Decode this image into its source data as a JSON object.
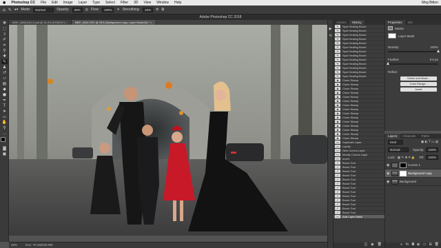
{
  "menubar": {
    "app": "Photoshop CC",
    "items": [
      "File",
      "Edit",
      "Image",
      "Layer",
      "Type",
      "Select",
      "Filter",
      "3D",
      "View",
      "Window",
      "Help"
    ],
    "user": "Meg Bitton"
  },
  "options": {
    "mode_label": "Mode:",
    "mode_value": "Normal",
    "opacity_label": "Opacity:",
    "opacity_value": "40%",
    "flow_label": "Flow:",
    "flow_value": "100%",
    "smoothing_label": "Smoothing:",
    "smoothing_value": "10%"
  },
  "window_title": "Adobe Photoshop CC 2018",
  "tabs": [
    {
      "label": "MBP_4585-644-2.psd @ 33.3% (RGB/16*)"
    },
    {
      "label": "MBP_4634.CR2 @ 25% (Background copy, Layer Mask/16) *"
    }
  ],
  "status": {
    "zoom": "25%",
    "doc": "Doc: 70.1M/234.9M"
  },
  "tools": [
    "move-icon",
    "marquee-icon",
    "lasso-icon",
    "quick-select-icon",
    "crop-icon",
    "eyedropper-icon",
    "healing-icon",
    "brush-icon",
    "clone-stamp-icon",
    "history-brush-icon",
    "eraser-icon",
    "gradient-icon",
    "blur-icon",
    "dodge-icon",
    "pen-icon",
    "type-icon",
    "path-select-icon",
    "rectangle-icon",
    "hand-icon",
    "zoom-icon",
    "more-icon",
    "colors-icon"
  ],
  "history": {
    "tabs": [
      "Actions",
      "History"
    ],
    "items": [
      {
        "label": "Spot Healing Brush",
        "icon": "spot-heal-icon"
      },
      {
        "label": "Spot Healing Brush",
        "icon": "spot-heal-icon"
      },
      {
        "label": "Spot Healing Brush",
        "icon": "spot-heal-icon"
      },
      {
        "label": "Spot Healing Brush",
        "icon": "spot-heal-icon"
      },
      {
        "label": "Spot Healing Brush",
        "icon": "spot-heal-icon"
      },
      {
        "label": "Spot Healing Brush",
        "icon": "spot-heal-icon"
      },
      {
        "label": "Spot Healing Brush",
        "icon": "spot-heal-icon"
      },
      {
        "label": "Spot Healing Brush",
        "icon": "spot-heal-icon"
      },
      {
        "label": "Spot Healing Brush",
        "icon": "spot-heal-icon"
      },
      {
        "label": "Spot Healing Brush",
        "icon": "spot-heal-icon"
      },
      {
        "label": "Spot Healing Brush",
        "icon": "spot-heal-icon"
      },
      {
        "label": "Spot Healing Brush",
        "icon": "spot-heal-icon"
      },
      {
        "label": "Spot Healing Brush",
        "icon": "spot-heal-icon"
      },
      {
        "label": "Clone Stamp",
        "icon": "clone-stamp-icon"
      },
      {
        "label": "Clone Stamp",
        "icon": "clone-stamp-icon"
      },
      {
        "label": "Clone Stamp",
        "icon": "clone-stamp-icon"
      },
      {
        "label": "Clone Stamp",
        "icon": "clone-stamp-icon"
      },
      {
        "label": "Clone Stamp",
        "icon": "clone-stamp-icon"
      },
      {
        "label": "Clone Stamp",
        "icon": "clone-stamp-icon"
      },
      {
        "label": "Clone Stamp",
        "icon": "clone-stamp-icon"
      },
      {
        "label": "Clone Stamp",
        "icon": "clone-stamp-icon"
      },
      {
        "label": "Clone Stamp",
        "icon": "clone-stamp-icon"
      },
      {
        "label": "Clone Stamp",
        "icon": "clone-stamp-icon"
      },
      {
        "label": "Clone Stamp",
        "icon": "clone-stamp-icon"
      },
      {
        "label": "Clone Stamp",
        "icon": "clone-stamp-icon"
      },
      {
        "label": "Clone Stamp",
        "icon": "clone-stamp-icon"
      },
      {
        "label": "Clone Stamp",
        "icon": "clone-stamp-icon"
      },
      {
        "label": "Clone Stamp",
        "icon": "clone-stamp-icon"
      },
      {
        "label": "Duplicate Layer",
        "icon": "layer-icon"
      },
      {
        "label": "Liquify",
        "icon": "layer-icon"
      },
      {
        "label": "New Curves Layer",
        "icon": "layer-icon"
      },
      {
        "label": "Modify Curves Layer",
        "icon": "layer-icon"
      },
      {
        "label": "Invert",
        "icon": "layer-icon"
      },
      {
        "label": "Brush Tool",
        "icon": "brush-icon"
      },
      {
        "label": "Brush Tool",
        "icon": "brush-icon"
      },
      {
        "label": "Brush Tool",
        "icon": "brush-icon"
      },
      {
        "label": "Brush Tool",
        "icon": "brush-icon"
      },
      {
        "label": "Brush Tool",
        "icon": "brush-icon"
      },
      {
        "label": "Brush Tool",
        "icon": "brush-icon"
      },
      {
        "label": "Brush Tool",
        "icon": "brush-icon"
      },
      {
        "label": "Brush Tool",
        "icon": "brush-icon"
      },
      {
        "label": "Brush Tool",
        "icon": "brush-icon"
      },
      {
        "label": "Brush Tool",
        "icon": "brush-icon"
      },
      {
        "label": "Brush Tool",
        "icon": "brush-icon"
      },
      {
        "label": "Brush Tool",
        "icon": "brush-icon"
      },
      {
        "label": "Brush Tool",
        "icon": "brush-icon"
      },
      {
        "label": "Add Layer Mask",
        "icon": "layer-icon",
        "active": true
      }
    ]
  },
  "properties": {
    "tabs": [
      "Properties",
      "Info"
    ],
    "section": "Masks",
    "layer_mask_label": "Layer Mask",
    "density_label": "Density:",
    "density_value": "100%",
    "density_fraction": 1.0,
    "feather_label": "Feather:",
    "feather_value": "0.0 px",
    "feather_fraction": 0.0,
    "refine_label": "Refine:",
    "btn_select_mask": "Select and Mask...",
    "btn_color_range": "Color Range...",
    "btn_invert": "Invert"
  },
  "layers": {
    "tabs": [
      "Layers",
      "Channels",
      "Paths"
    ],
    "kind_label": "Kind",
    "blend_value": "Normal",
    "opacity_label": "Opacity:",
    "opacity_value": "100%",
    "lock_label": "Lock:",
    "fill_label": "Fill:",
    "fill_value": "100%",
    "items": [
      {
        "name": "Curves 1",
        "active": false
      },
      {
        "name": "Background copy",
        "active": true
      },
      {
        "name": "Background",
        "active": false
      }
    ]
  },
  "colors": {
    "accent": "#2d8ceb",
    "panel": "#3c3c3c",
    "dark": "#262626",
    "menubar": "#e9e9e9"
  }
}
